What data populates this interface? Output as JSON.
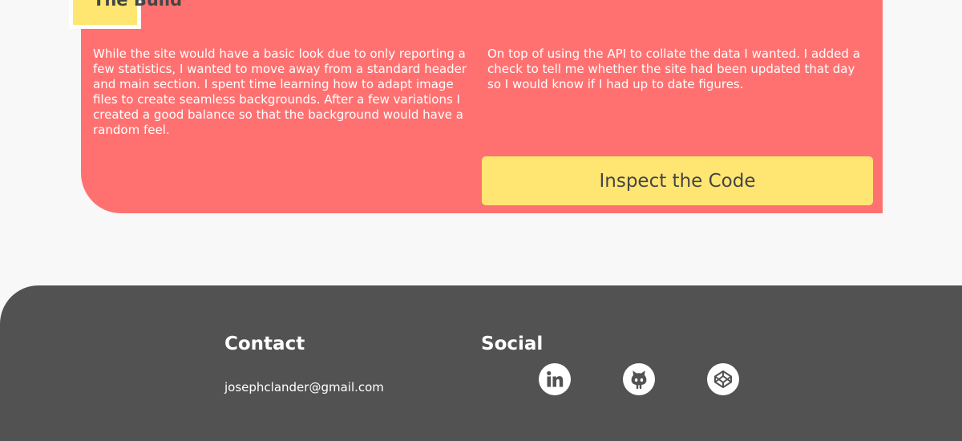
{
  "build": {
    "title": "The Build",
    "left_paragraph": "While the site would have a basic look due to only reporting a few statistics, I wanted to move away from a standard header and main section. I spent time learning how to adapt image files to create seamless backgrounds. After a few variations I created a good balance so that the background would have a random feel.",
    "right_paragraph": "On top of using the API to collate the data I wanted. I added a check to tell me whether the site had been updated that day so I would know if I had up to date figures.",
    "button_label": "Inspect the Code"
  },
  "footer": {
    "contact_heading": "Contact",
    "email": "josephclander@gmail.com",
    "social_heading": "Social",
    "social_icons": [
      "linkedin-icon",
      "github-icon",
      "codepen-icon"
    ]
  },
  "colors": {
    "page_background": "#f8f8f8",
    "card_background": "#ff7171",
    "accent_yellow": "#ffe673",
    "footer_background": "#525252",
    "text_dark": "#454545",
    "text_light": "#ffffff"
  }
}
